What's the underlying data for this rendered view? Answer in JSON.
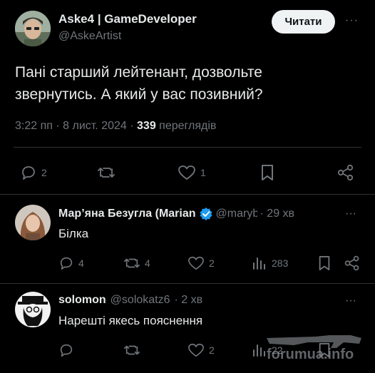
{
  "main_post": {
    "author_name": "Aske4 | GameDeveloper",
    "author_handle": "@AskeArtist",
    "follow_label": "Читати",
    "more_label": "···",
    "text_line1": "Пані старший лейтенант, дозвольте",
    "text_line2": "звернутись. А який у вас позивний?",
    "timestamp": "3:22 пп · 8 лист. 2024 ·",
    "views_count": "339",
    "views_label": "переглядів",
    "actions": {
      "replies": "2",
      "retweets": "",
      "likes": "1"
    }
  },
  "replies": [
    {
      "author_name": "Мар’яна Безугла (Marian",
      "handle": "@marybe",
      "time": "· 29 хв",
      "text": "Білка",
      "more_label": "···",
      "actions": {
        "replies": "4",
        "retweets": "4",
        "likes": "2",
        "views": "283"
      }
    },
    {
      "author_name": "solomon",
      "handle": "@solokatz6",
      "time": "· 2 хв",
      "text": "Нарешті якесь пояснення",
      "more_label": "···",
      "actions": {
        "replies": "",
        "retweets": "",
        "likes": "2",
        "views": "22"
      }
    }
  ],
  "watermark": "forumua.info",
  "colors": {
    "background": "#000000",
    "text": "#e7e9ea",
    "muted": "#71767b",
    "verified": "#1d9bf0",
    "divider": "#2f3336"
  }
}
